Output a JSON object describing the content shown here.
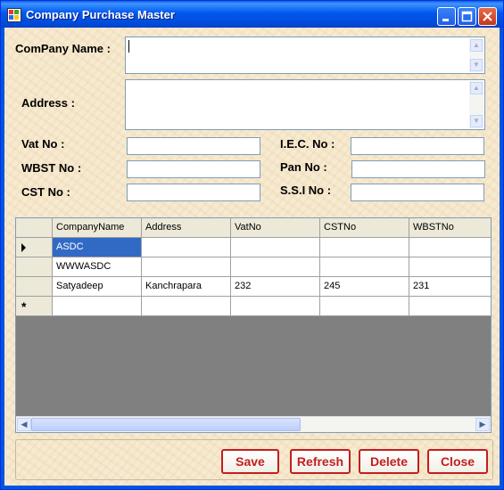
{
  "window": {
    "title": "Company Purchase Master"
  },
  "form": {
    "company_name_label": "ComPany Name :",
    "company_name_value": "",
    "address_label": "Address :",
    "address_value": "",
    "vat_label": "Vat No :",
    "vat_value": "",
    "wbst_label": "WBST No :",
    "wbst_value": "",
    "cst_label": "CST No :",
    "cst_value": "",
    "iec_label": "I.E.C. No :",
    "iec_value": "",
    "pan_label": "Pan No :",
    "pan_value": "",
    "ssi_label": "S.S.I No :",
    "ssi_value": ""
  },
  "grid": {
    "columns": [
      "CompanyName",
      "Address",
      "VatNo",
      "CSTNo",
      "WBSTNo"
    ],
    "rows": [
      [
        "ASDC",
        "",
        "",
        "",
        ""
      ],
      [
        "WWWASDC",
        "",
        "",
        "",
        ""
      ],
      [
        "Satyadeep",
        "Kanchrapara",
        "232",
        "245",
        "231"
      ]
    ],
    "new_row_marker": "*"
  },
  "buttons": {
    "save": "Save",
    "refresh": "Refresh",
    "delete": "Delete",
    "close": "Close"
  }
}
